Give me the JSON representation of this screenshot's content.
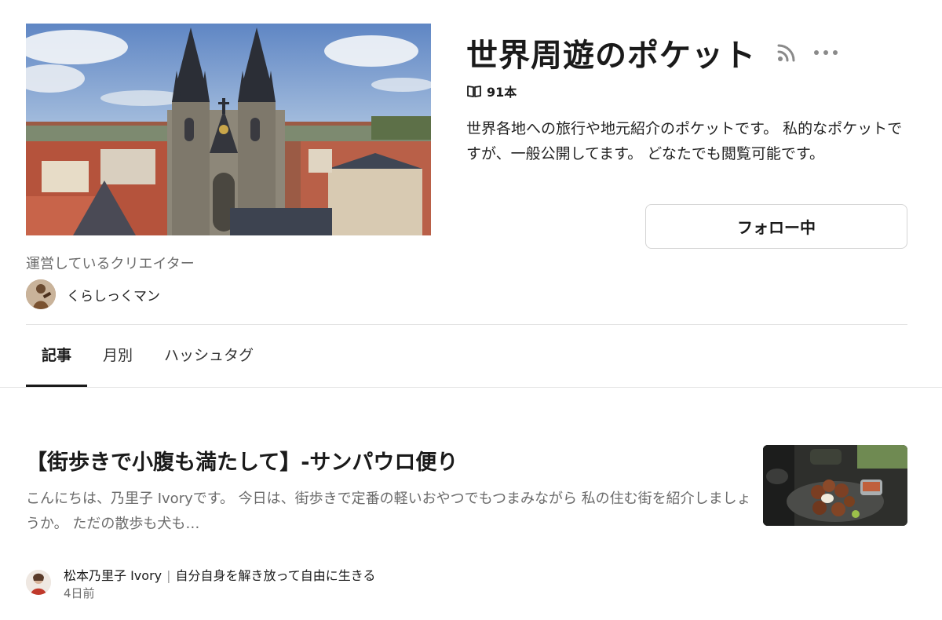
{
  "magazine": {
    "title": "世界周遊のポケット",
    "article_count": "91本",
    "description": "世界各地への旅行や地元紹介のポケットです。 私的なポケットですが、一般公開してます。 どなたでも閲覧可能です。",
    "follow_label": "フォロー中",
    "rss_icon": "rss-icon",
    "more_icon": "more-dots-icon",
    "book_icon": "book-icon"
  },
  "creator": {
    "label": "運営しているクリエイター",
    "name": "くらしっくマン"
  },
  "tabs": [
    {
      "label": "記事",
      "active": true
    },
    {
      "label": "月別",
      "active": false
    },
    {
      "label": "ハッシュタグ",
      "active": false
    }
  ],
  "article": {
    "title": "【街歩きで小腹も満たして】-サンパウロ便り",
    "excerpt": "こんにちは、乃里子 Ivoryです。 今日は、街歩きで定番の軽いおやつでもつまみながら 私の住む街を紹介しましょうか。 ただの散歩も犬も…",
    "author": "松本乃里子 Ivory",
    "author_separator": "|",
    "author_tagline": "自分自身を解き放って自由に生きる",
    "date": "4日前"
  },
  "colors": {
    "text": "#1a1a1a",
    "muted": "#6b6b6b",
    "divider": "#e3e3e3",
    "button_border": "#d4d4d4"
  }
}
